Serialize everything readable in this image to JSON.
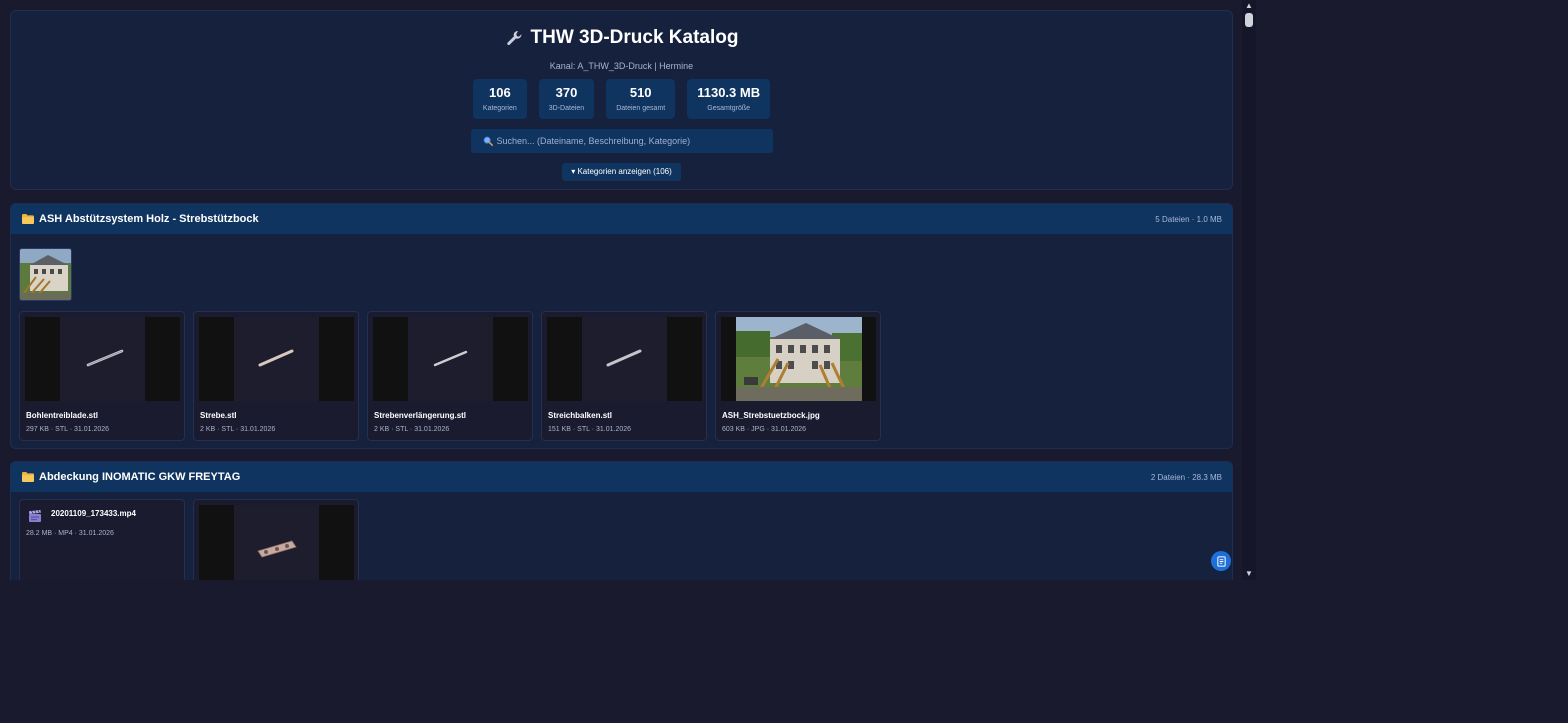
{
  "header": {
    "title": "THW 3D-Druck Katalog",
    "subtitle": "Kanal: A_THW_3D-Druck | Hermine",
    "stats": [
      {
        "value": "106",
        "label": "Kategorien"
      },
      {
        "value": "370",
        "label": "3D-Dateien"
      },
      {
        "value": "510",
        "label": "Dateien gesamt"
      },
      {
        "value": "1130.3 MB",
        "label": "Gesamtgröße"
      }
    ],
    "search_placeholder": "Suchen... (Dateiname, Beschreibung, Kategorie)",
    "toggle_label": "▾ Kategorien anzeigen (106)"
  },
  "sections": [
    {
      "title": "ASH Abstützsystem Holz - Strebstützbock",
      "meta": "5 Dateien · 1.0 MB",
      "files": [
        {
          "name": "Bohlentreiblade.stl",
          "meta": "297 KB · STL · 31.01.2026"
        },
        {
          "name": "Strebe.stl",
          "meta": "2 KB · STL · 31.01.2026"
        },
        {
          "name": "Strebenverlängerung.stl",
          "meta": "2 KB · STL · 31.01.2026"
        },
        {
          "name": "Streichbalken.stl",
          "meta": "151 KB · STL · 31.01.2026"
        },
        {
          "name": "ASH_Strebstuetzbock.jpg",
          "meta": "603 KB · JPG · 31.01.2026"
        }
      ]
    },
    {
      "title": "Abdeckung INOMATIC GKW FREYTAG",
      "meta": "2 Dateien · 28.3 MB",
      "files": [
        {
          "name": "20201109_173433.mp4",
          "meta": "28.2 MB · MP4 · 31.01.2026"
        }
      ]
    }
  ],
  "icons": {
    "title": "wrench-icon",
    "section": "folder-icon",
    "search": "magnifier-icon",
    "video": "clapperboard-icon",
    "fab": "notes-icon"
  },
  "colors": {
    "background": "#1a1a2e",
    "panel": "#16213e",
    "accent": "#0f3460",
    "fab": "#1e6fd9"
  }
}
